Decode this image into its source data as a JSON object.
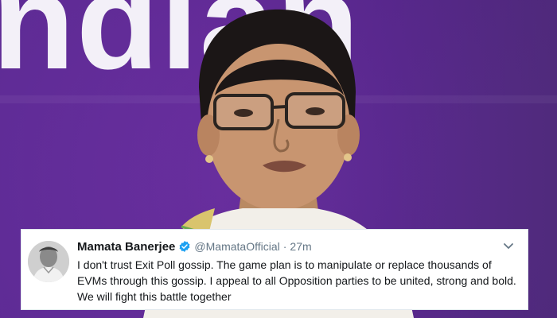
{
  "background": {
    "banner_text": "ndian"
  },
  "tweet": {
    "display_name": "Mamata Banerjee",
    "handle": "@MamataOfficial",
    "separator": "·",
    "time": "27m",
    "text": "I don't trust Exit Poll gossip. The game plan is to manipulate or replace thousands of EVMs through this gossip. I appeal to all Opposition parties to be united, strong and bold. We will fight this battle together",
    "verified_icon": "verified-badge-icon",
    "menu_icon": "chevron-down-icon"
  },
  "colors": {
    "banner_bg": "#6a33a4",
    "verified": "#1da1f2",
    "name": "#14171a",
    "meta": "#657786"
  }
}
